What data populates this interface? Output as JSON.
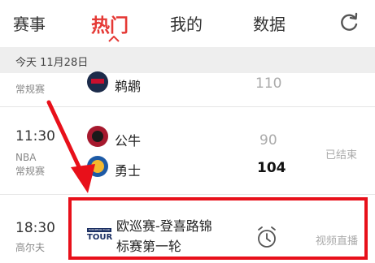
{
  "tabs": [
    {
      "label": "赛事"
    },
    {
      "label": "热门"
    },
    {
      "label": "我的"
    },
    {
      "label": "数据"
    }
  ],
  "date_label": "今天  11月28日",
  "rows": [
    {
      "league": "常规赛",
      "team": "鹈鹕",
      "score": "110"
    },
    {
      "time": "11:30",
      "league_lines": [
        "NBA",
        "常规赛"
      ],
      "teams": [
        {
          "name": "公牛",
          "score": "90"
        },
        {
          "name": "勇士",
          "score": "104"
        }
      ],
      "status": "已结束"
    },
    {
      "time": "18:30",
      "league": "高尔夫",
      "title_lines": [
        "欧巡赛-登喜路锦",
        "标赛第一轮"
      ],
      "logo_text": "TOUR",
      "logo_subtext": "EUROPEAN TOUR",
      "status": "视频直播"
    }
  ],
  "colors": {
    "accent": "#e53935",
    "annotation": "#e8101a"
  }
}
